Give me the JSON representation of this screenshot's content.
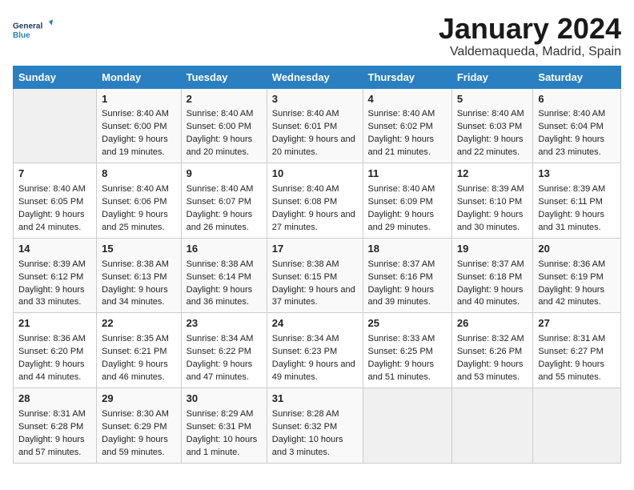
{
  "header": {
    "logo_line1": "General",
    "logo_line2": "Blue",
    "month": "January 2024",
    "location": "Valdemaqueda, Madrid, Spain"
  },
  "days_of_week": [
    "Sunday",
    "Monday",
    "Tuesday",
    "Wednesday",
    "Thursday",
    "Friday",
    "Saturday"
  ],
  "weeks": [
    [
      {
        "day": "",
        "empty": true
      },
      {
        "day": "1",
        "sunrise": "Sunrise: 8:40 AM",
        "sunset": "Sunset: 6:00 PM",
        "daylight": "Daylight: 9 hours and 19 minutes."
      },
      {
        "day": "2",
        "sunrise": "Sunrise: 8:40 AM",
        "sunset": "Sunset: 6:00 PM",
        "daylight": "Daylight: 9 hours and 20 minutes."
      },
      {
        "day": "3",
        "sunrise": "Sunrise: 8:40 AM",
        "sunset": "Sunset: 6:01 PM",
        "daylight": "Daylight: 9 hours and 20 minutes."
      },
      {
        "day": "4",
        "sunrise": "Sunrise: 8:40 AM",
        "sunset": "Sunset: 6:02 PM",
        "daylight": "Daylight: 9 hours and 21 minutes."
      },
      {
        "day": "5",
        "sunrise": "Sunrise: 8:40 AM",
        "sunset": "Sunset: 6:03 PM",
        "daylight": "Daylight: 9 hours and 22 minutes."
      },
      {
        "day": "6",
        "sunrise": "Sunrise: 8:40 AM",
        "sunset": "Sunset: 6:04 PM",
        "daylight": "Daylight: 9 hours and 23 minutes."
      }
    ],
    [
      {
        "day": "7",
        "sunrise": "Sunrise: 8:40 AM",
        "sunset": "Sunset: 6:05 PM",
        "daylight": "Daylight: 9 hours and 24 minutes."
      },
      {
        "day": "8",
        "sunrise": "Sunrise: 8:40 AM",
        "sunset": "Sunset: 6:06 PM",
        "daylight": "Daylight: 9 hours and 25 minutes."
      },
      {
        "day": "9",
        "sunrise": "Sunrise: 8:40 AM",
        "sunset": "Sunset: 6:07 PM",
        "daylight": "Daylight: 9 hours and 26 minutes."
      },
      {
        "day": "10",
        "sunrise": "Sunrise: 8:40 AM",
        "sunset": "Sunset: 6:08 PM",
        "daylight": "Daylight: 9 hours and 27 minutes."
      },
      {
        "day": "11",
        "sunrise": "Sunrise: 8:40 AM",
        "sunset": "Sunset: 6:09 PM",
        "daylight": "Daylight: 9 hours and 29 minutes."
      },
      {
        "day": "12",
        "sunrise": "Sunrise: 8:39 AM",
        "sunset": "Sunset: 6:10 PM",
        "daylight": "Daylight: 9 hours and 30 minutes."
      },
      {
        "day": "13",
        "sunrise": "Sunrise: 8:39 AM",
        "sunset": "Sunset: 6:11 PM",
        "daylight": "Daylight: 9 hours and 31 minutes."
      }
    ],
    [
      {
        "day": "14",
        "sunrise": "Sunrise: 8:39 AM",
        "sunset": "Sunset: 6:12 PM",
        "daylight": "Daylight: 9 hours and 33 minutes."
      },
      {
        "day": "15",
        "sunrise": "Sunrise: 8:38 AM",
        "sunset": "Sunset: 6:13 PM",
        "daylight": "Daylight: 9 hours and 34 minutes."
      },
      {
        "day": "16",
        "sunrise": "Sunrise: 8:38 AM",
        "sunset": "Sunset: 6:14 PM",
        "daylight": "Daylight: 9 hours and 36 minutes."
      },
      {
        "day": "17",
        "sunrise": "Sunrise: 8:38 AM",
        "sunset": "Sunset: 6:15 PM",
        "daylight": "Daylight: 9 hours and 37 minutes."
      },
      {
        "day": "18",
        "sunrise": "Sunrise: 8:37 AM",
        "sunset": "Sunset: 6:16 PM",
        "daylight": "Daylight: 9 hours and 39 minutes."
      },
      {
        "day": "19",
        "sunrise": "Sunrise: 8:37 AM",
        "sunset": "Sunset: 6:18 PM",
        "daylight": "Daylight: 9 hours and 40 minutes."
      },
      {
        "day": "20",
        "sunrise": "Sunrise: 8:36 AM",
        "sunset": "Sunset: 6:19 PM",
        "daylight": "Daylight: 9 hours and 42 minutes."
      }
    ],
    [
      {
        "day": "21",
        "sunrise": "Sunrise: 8:36 AM",
        "sunset": "Sunset: 6:20 PM",
        "daylight": "Daylight: 9 hours and 44 minutes."
      },
      {
        "day": "22",
        "sunrise": "Sunrise: 8:35 AM",
        "sunset": "Sunset: 6:21 PM",
        "daylight": "Daylight: 9 hours and 46 minutes."
      },
      {
        "day": "23",
        "sunrise": "Sunrise: 8:34 AM",
        "sunset": "Sunset: 6:22 PM",
        "daylight": "Daylight: 9 hours and 47 minutes."
      },
      {
        "day": "24",
        "sunrise": "Sunrise: 8:34 AM",
        "sunset": "Sunset: 6:23 PM",
        "daylight": "Daylight: 9 hours and 49 minutes."
      },
      {
        "day": "25",
        "sunrise": "Sunrise: 8:33 AM",
        "sunset": "Sunset: 6:25 PM",
        "daylight": "Daylight: 9 hours and 51 minutes."
      },
      {
        "day": "26",
        "sunrise": "Sunrise: 8:32 AM",
        "sunset": "Sunset: 6:26 PM",
        "daylight": "Daylight: 9 hours and 53 minutes."
      },
      {
        "day": "27",
        "sunrise": "Sunrise: 8:31 AM",
        "sunset": "Sunset: 6:27 PM",
        "daylight": "Daylight: 9 hours and 55 minutes."
      }
    ],
    [
      {
        "day": "28",
        "sunrise": "Sunrise: 8:31 AM",
        "sunset": "Sunset: 6:28 PM",
        "daylight": "Daylight: 9 hours and 57 minutes."
      },
      {
        "day": "29",
        "sunrise": "Sunrise: 8:30 AM",
        "sunset": "Sunset: 6:29 PM",
        "daylight": "Daylight: 9 hours and 59 minutes."
      },
      {
        "day": "30",
        "sunrise": "Sunrise: 8:29 AM",
        "sunset": "Sunset: 6:31 PM",
        "daylight": "Daylight: 10 hours and 1 minute."
      },
      {
        "day": "31",
        "sunrise": "Sunrise: 8:28 AM",
        "sunset": "Sunset: 6:32 PM",
        "daylight": "Daylight: 10 hours and 3 minutes."
      },
      {
        "day": "",
        "empty": true
      },
      {
        "day": "",
        "empty": true
      },
      {
        "day": "",
        "empty": true
      }
    ]
  ]
}
